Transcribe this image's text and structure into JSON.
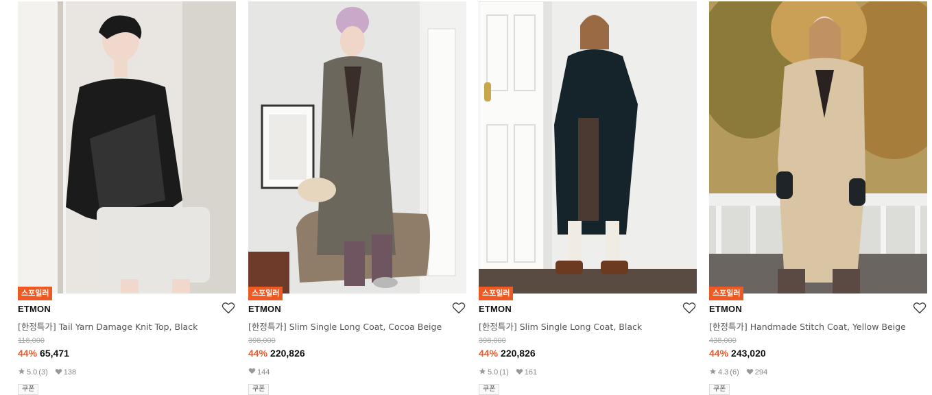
{
  "colors": {
    "accent": "#ee5a24",
    "text": "#111111",
    "muted": "#888888"
  },
  "products": [
    {
      "badge": "스포일러",
      "brand": "ETMON",
      "title": "[한정특가] Tail Yarn Damage Knit Top, Black",
      "original_price": "118,000",
      "discount": "44%",
      "price": "65,471",
      "rating": "5.0",
      "review_count": "(3)",
      "likes": "138",
      "coupon": "쿠폰",
      "photo": {
        "bg": "#e9e6e1",
        "outfit": "#1b1b1b",
        "lower": "#e8e6e3",
        "scene": "knit-top"
      }
    },
    {
      "badge": "스포일러",
      "brand": "ETMON",
      "title": "[한정특가] Slim Single Long Coat, Cocoa Beige",
      "original_price": "398,000",
      "discount": "44%",
      "price": "220,826",
      "rating": "",
      "review_count": "",
      "likes": "144",
      "coupon": "쿠폰",
      "photo": {
        "bg": "#e6e6e4",
        "outfit": "#6b675c",
        "lower": "#6e5560",
        "scene": "grey-coat"
      }
    },
    {
      "badge": "스포일러",
      "brand": "ETMON",
      "title": "[한정특가] Slim Single Long Coat, Black",
      "original_price": "398,000",
      "discount": "44%",
      "price": "220,826",
      "rating": "5.0",
      "review_count": "(1)",
      "likes": "161",
      "coupon": "쿠폰",
      "photo": {
        "bg": "#eeeeec",
        "outfit": "#14242a",
        "lower": "#4a3a32",
        "scene": "black-coat"
      }
    },
    {
      "badge": "스포일러",
      "brand": "ETMON",
      "title": "[한정특가] Handmade Stitch Coat, Yellow Beige",
      "original_price": "438,000",
      "discount": "44%",
      "price": "243,020",
      "rating": "4.3",
      "review_count": "(6)",
      "likes": "294",
      "coupon": "쿠폰",
      "photo": {
        "bg": "#b59a5e",
        "outfit": "#d9c5a3",
        "lower": "#5b4a44",
        "scene": "beige-coat"
      }
    }
  ]
}
